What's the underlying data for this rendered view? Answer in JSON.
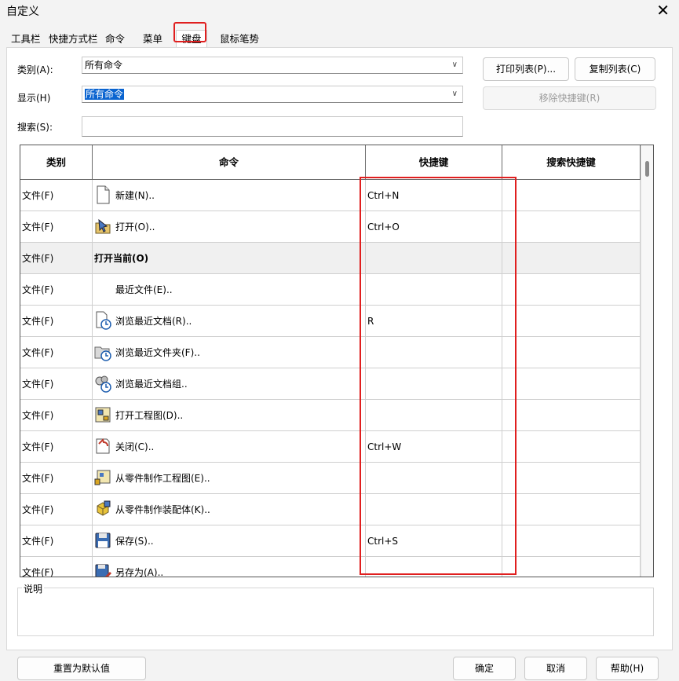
{
  "window": {
    "title": "自定义",
    "close_label": "✕"
  },
  "tabs": [
    {
      "label": "工具栏"
    },
    {
      "label": "快捷方式栏"
    },
    {
      "label": "命令"
    },
    {
      "label": "菜单"
    },
    {
      "label": "键盘"
    },
    {
      "label": "鼠标笔势"
    }
  ],
  "form": {
    "category_label": "类别(A):",
    "category_value": "所有命令",
    "show_label": "显示(H)",
    "show_value": "所有命令",
    "search_label": "搜索(S):",
    "search_value": ""
  },
  "buttons": {
    "print_list": "打印列表(P)...",
    "copy_list": "复制列表(C)",
    "remove_shortcut": "移除快捷键(R)"
  },
  "table": {
    "columns": [
      "类别",
      "命令",
      "快捷键",
      "搜索快捷键"
    ],
    "rows": [
      {
        "category": "文件(F)",
        "command": "新建(N)..",
        "shortcut": "Ctrl+N",
        "search_shortcut": "",
        "icon": "new-document-icon"
      },
      {
        "category": "文件(F)",
        "command": "打开(O)..",
        "shortcut": "Ctrl+O",
        "search_shortcut": "",
        "icon": "open-folder-icon"
      },
      {
        "category": "文件(F)",
        "command": "打开当前(O)",
        "shortcut": "",
        "search_shortcut": "",
        "icon": "",
        "group": true
      },
      {
        "category": "文件(F)",
        "command": "最近文件(E)..",
        "shortcut": "",
        "search_shortcut": "",
        "icon": ""
      },
      {
        "category": "文件(F)",
        "command": "浏览最近文档(R)..",
        "shortcut": "R",
        "search_shortcut": "",
        "icon": "recent-document-icon"
      },
      {
        "category": "文件(F)",
        "command": "浏览最近文件夹(F)..",
        "shortcut": "",
        "search_shortcut": "",
        "icon": "recent-folder-icon"
      },
      {
        "category": "文件(F)",
        "command": "浏览最近文档组..",
        "shortcut": "",
        "search_shortcut": "",
        "icon": "recent-group-icon"
      },
      {
        "category": "文件(F)",
        "command": "打开工程图(D)..",
        "shortcut": "",
        "search_shortcut": "",
        "icon": "open-drawing-icon"
      },
      {
        "category": "文件(F)",
        "command": "关闭(C)..",
        "shortcut": "Ctrl+W",
        "search_shortcut": "",
        "icon": "close-document-icon"
      },
      {
        "category": "文件(F)",
        "command": "从零件制作工程图(E)..",
        "shortcut": "",
        "search_shortcut": "",
        "icon": "make-drawing-icon"
      },
      {
        "category": "文件(F)",
        "command": "从零件制作装配体(K)..",
        "shortcut": "",
        "search_shortcut": "",
        "icon": "make-assembly-icon"
      },
      {
        "category": "文件(F)",
        "command": "保存(S)..",
        "shortcut": "Ctrl+S",
        "search_shortcut": "",
        "icon": "save-icon"
      },
      {
        "category": "文件(F)",
        "command": "另存为(A)..",
        "shortcut": "",
        "search_shortcut": "",
        "icon": "save-as-icon"
      }
    ]
  },
  "description": {
    "label": "说明",
    "text": ""
  },
  "footer": {
    "reset": "重置为默认值",
    "ok": "确定",
    "cancel": "取消",
    "help": "帮助(H)"
  },
  "colors": {
    "highlight": "#e01f1f",
    "selection": "#0a64d0"
  }
}
